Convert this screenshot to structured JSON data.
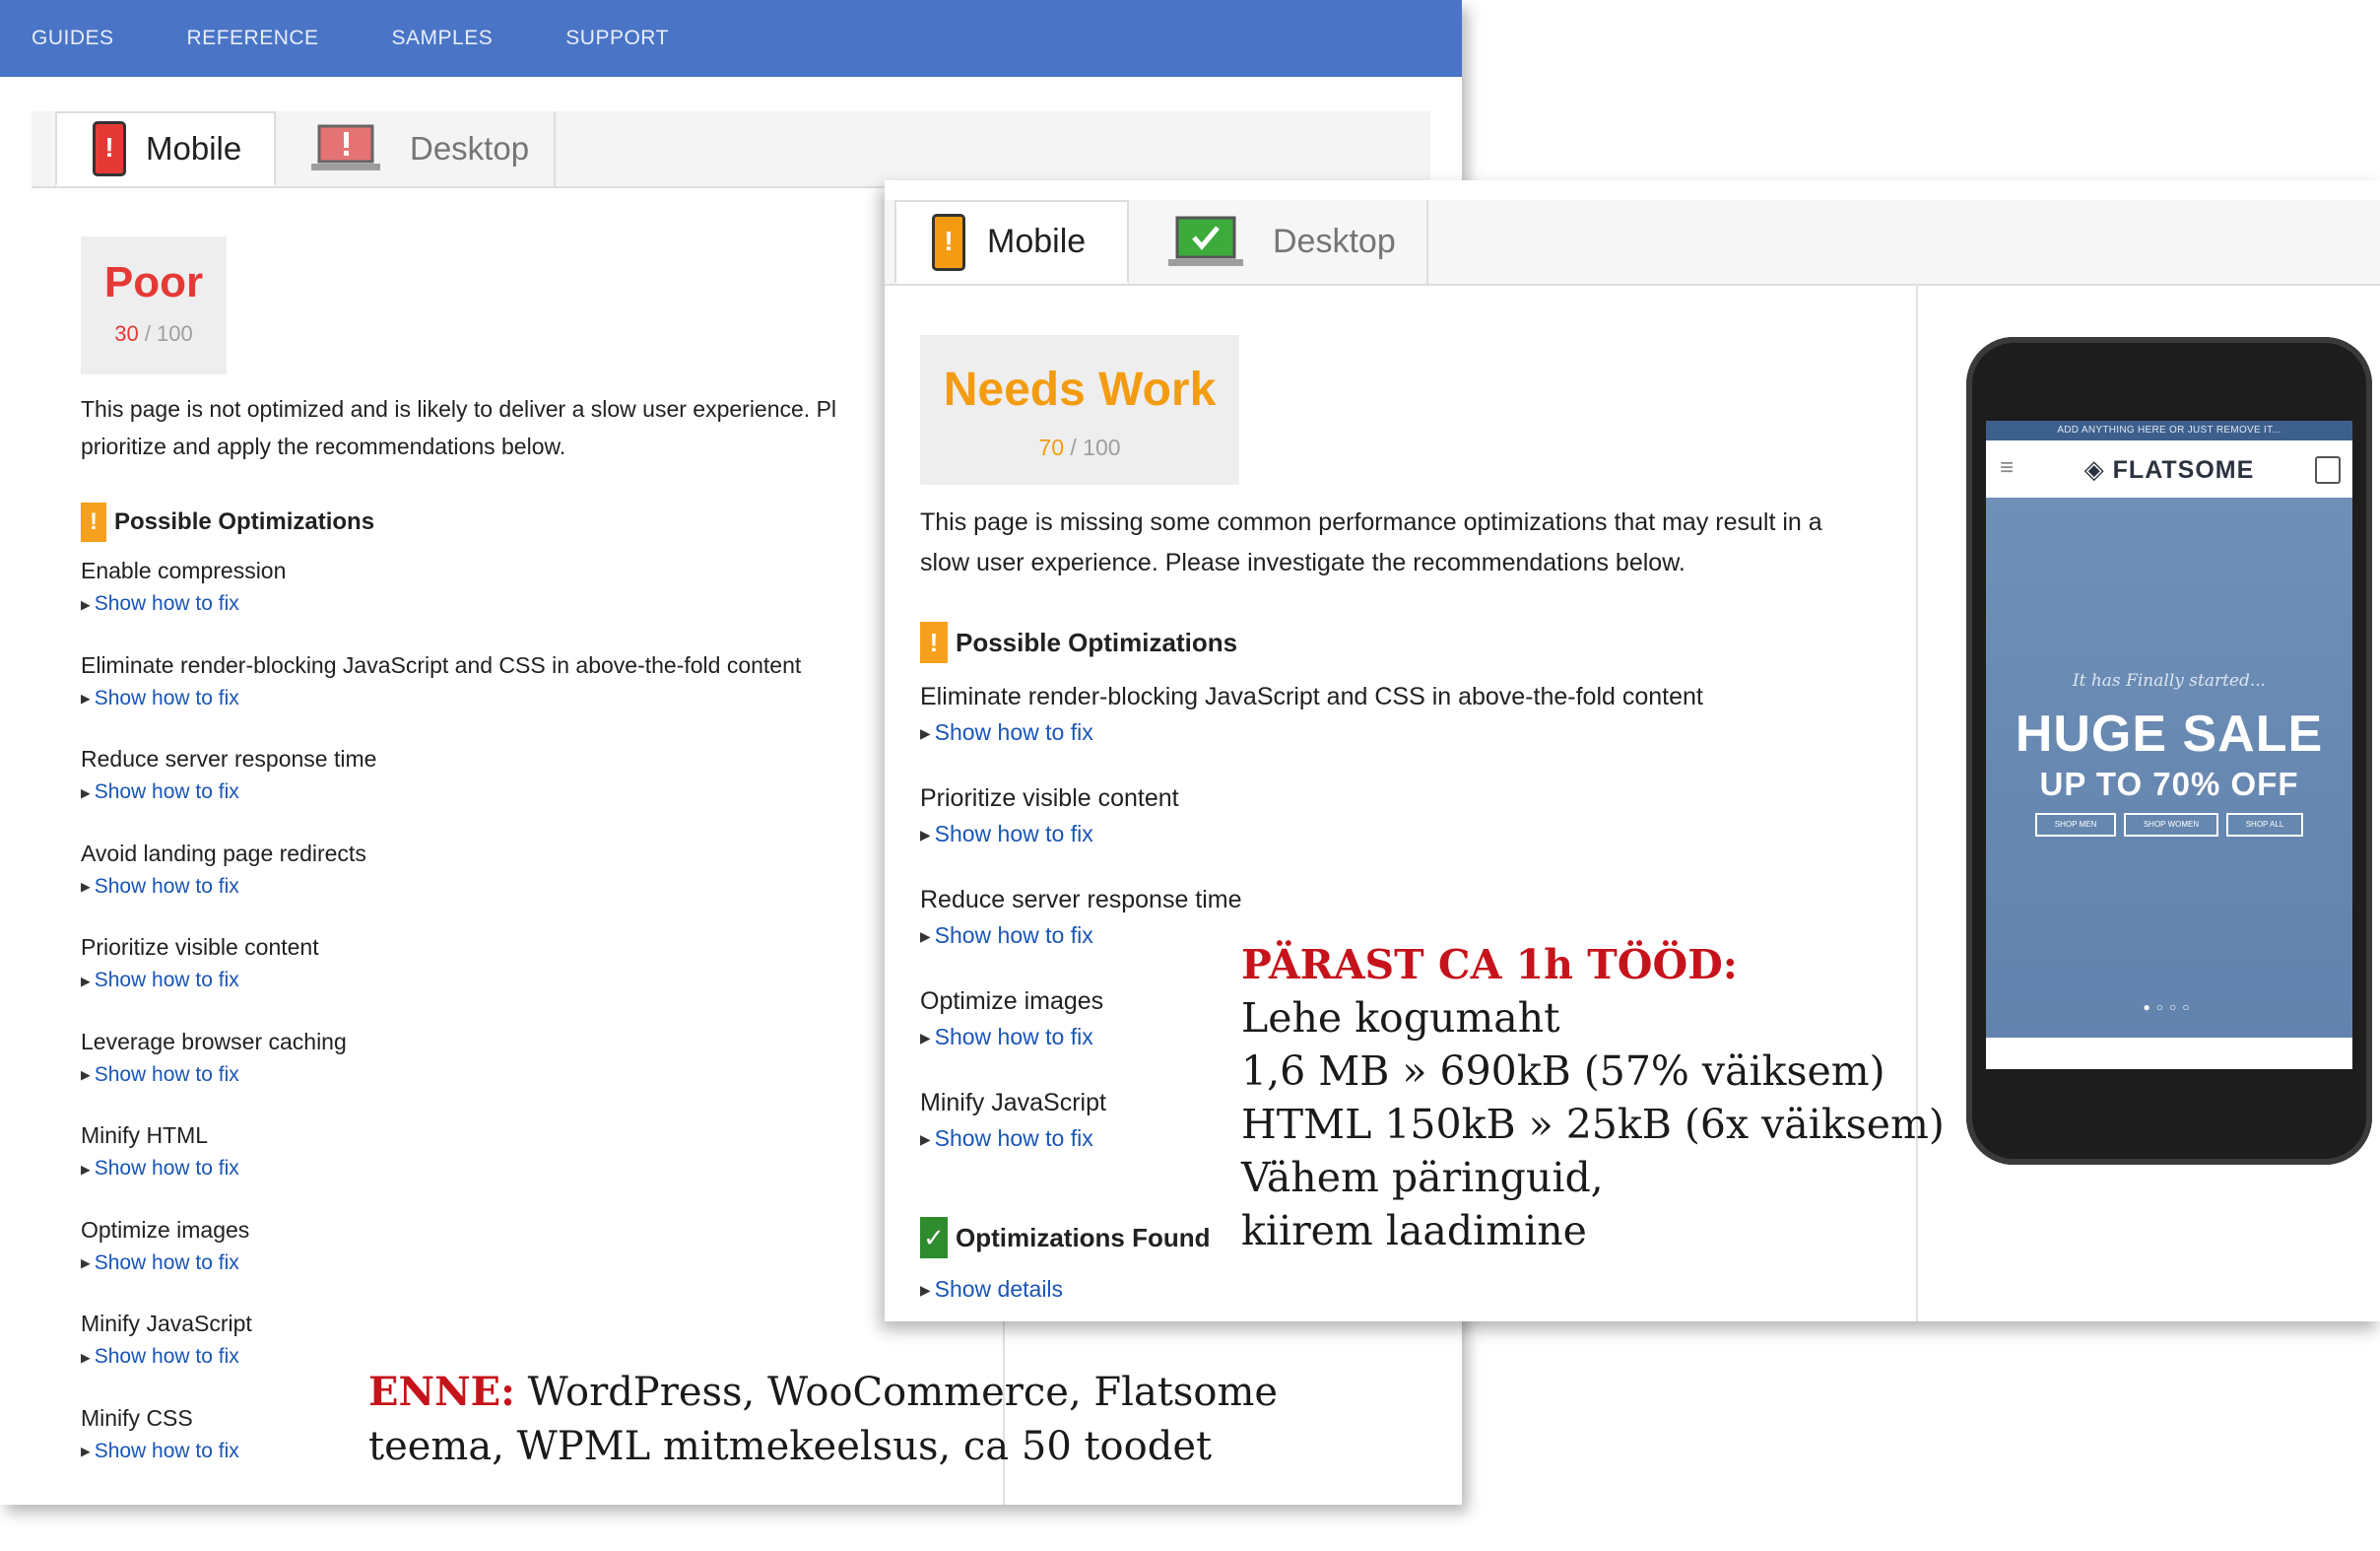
{
  "nav": {
    "items": [
      "GUIDES",
      "REFERENCE",
      "SAMPLES",
      "SUPPORT"
    ]
  },
  "before": {
    "tabs": {
      "mobile": "Mobile",
      "desktop": "Desktop"
    },
    "score": {
      "label": "Poor",
      "value": "30",
      "max": "/ 100",
      "color": "#e53935"
    },
    "description_line1": "This page is not optimized and is likely to deliver a slow user experience. Pl",
    "description_line2": "prioritize and apply the recommendations below.",
    "section": "Possible Optimizations",
    "link_label": "Show how to fix",
    "optimizations": [
      "Enable compression",
      "Eliminate render-blocking JavaScript and CSS in above-the-fold content",
      "Reduce server response time",
      "Avoid landing page redirects",
      "Prioritize visible content",
      "Leverage browser caching",
      "Minify HTML",
      "Optimize images",
      "Minify JavaScript",
      "Minify CSS"
    ]
  },
  "after": {
    "tabs": {
      "mobile": "Mobile",
      "desktop": "Desktop"
    },
    "score": {
      "label": "Needs Work",
      "value": "70",
      "max": "/ 100",
      "color": "#f39c12"
    },
    "description_line1": "This page is missing some common performance optimizations that may result in a",
    "description_line2": "slow user experience. Please investigate the recommendations below.",
    "section": "Possible Optimizations",
    "link_label": "Show how to fix",
    "optimizations": [
      "Eliminate render-blocking JavaScript and CSS in above-the-fold content",
      "Prioritize visible content",
      "Reduce server response time",
      "Optimize images",
      "Minify JavaScript"
    ],
    "found_section": "Optimizations Found",
    "show_details": "Show details"
  },
  "phone": {
    "topbar": "ADD ANYTHING HERE OR JUST REMOVE IT...",
    "logo": "FLATSOME",
    "script": "It has Finally started...",
    "headline": "HUGE SALE",
    "subline": "UP TO 70% OFF",
    "buttons": [
      "SHOP MEN",
      "SHOP WOMEN",
      "SHOP ALL"
    ],
    "dots": "●○○○"
  },
  "annotations": {
    "after_title": "PÄRAST CA 1h TÖÖD:",
    "after_lines": [
      "Lehe kogumaht",
      "1,6 MB » 690kB (57% väiksem)",
      "HTML 150kB » 25kB (6x väiksem)",
      "Vähem päringuid,",
      "kiirem laadimine"
    ],
    "before_label": "ENNE:",
    "before_line1": " WordPress, WooCommerce, Flatsome",
    "before_line2": "teema,  WPML mitmekeelsus, ca 50 toodet"
  }
}
